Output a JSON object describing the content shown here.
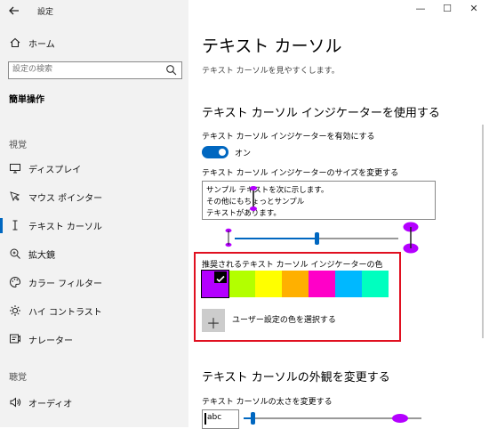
{
  "window": {
    "title": "設定",
    "minimize_glyph": "—",
    "maximize_glyph": "☐",
    "close_glyph": "✕"
  },
  "sidebar": {
    "home_label": "ホーム",
    "search_placeholder": "設定の検索",
    "category_title": "簡単操作",
    "sections": [
      {
        "header": "視覚",
        "items": [
          {
            "label": "ディスプレイ",
            "icon": "display-icon"
          },
          {
            "label": "マウス ポインター",
            "icon": "mouse-pointer-icon"
          },
          {
            "label": "テキスト カーソル",
            "icon": "text-cursor-icon",
            "selected": true
          },
          {
            "label": "拡大鏡",
            "icon": "magnifier-icon"
          },
          {
            "label": "カラー フィルター",
            "icon": "color-filter-icon"
          },
          {
            "label": "ハイ コントラスト",
            "icon": "high-contrast-icon"
          },
          {
            "label": "ナレーター",
            "icon": "narrator-icon"
          }
        ]
      },
      {
        "header": "聴覚",
        "items": [
          {
            "label": "オーディオ",
            "icon": "audio-icon"
          }
        ]
      }
    ]
  },
  "main": {
    "page_title": "テキスト カーソル",
    "page_subtitle": "テキスト カーソルを見やすくします。",
    "indicator_heading": "テキスト カーソル インジケーターを使用する",
    "toggle_label": "テキスト カーソル インジケーターを有効にする",
    "toggle_state": "オン",
    "size_label": "テキスト カーソル インジケーターのサイズを変更する",
    "sample_lines": [
      "サンプル テキストを次に示します。",
      "その他にもちょっとサンプル",
      "テキストがあります。"
    ],
    "size_slider_value": 0.5,
    "recommended_colors_label": "推奨されるテキスト カーソル インジケーターの色",
    "colors": [
      {
        "name": "purple",
        "hex": "#b400ff",
        "selected": true
      },
      {
        "name": "lime",
        "hex": "#b3ff00"
      },
      {
        "name": "yellow",
        "hex": "#ffff00"
      },
      {
        "name": "orange",
        "hex": "#ffb000"
      },
      {
        "name": "magenta",
        "hex": "#ff00c8"
      },
      {
        "name": "sky-blue",
        "hex": "#00b8ff"
      },
      {
        "name": "aqua",
        "hex": "#00ffbf"
      }
    ],
    "custom_color_label": "ユーザー設定の色を選択する",
    "custom_color_glyph": "＋",
    "appearance_heading": "テキスト カーソルの外観を変更する",
    "thickness_label": "テキスト カーソルの太さを変更する",
    "thickness_preview_text": "abc",
    "thickness_slider_value": 0.05
  },
  "colors": {
    "accent": "#0067c0",
    "indicator": "#b400ff",
    "highlight_border": "#e01020",
    "sidebar_bg": "#f2f2f2"
  }
}
